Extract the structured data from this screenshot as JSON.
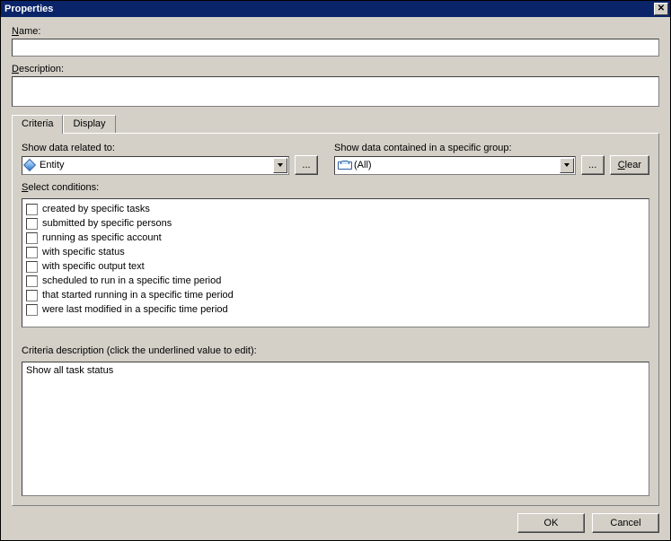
{
  "window": {
    "title": "Properties"
  },
  "fields": {
    "name_label_pre": "N",
    "name_label_post": "ame:",
    "name_value": "",
    "desc_label_pre": "D",
    "desc_label_post": "escription:",
    "desc_value": ""
  },
  "tabs": {
    "criteria": "Criteria",
    "display": "Display"
  },
  "criteria_panel": {
    "related_label": "Show data related to:",
    "related_value": "Entity",
    "group_label": "Show data contained in a specific group:",
    "group_value": "(All)",
    "browse_label": "...",
    "clear_pre": "C",
    "clear_post": "lear",
    "conditions_label_pre": "S",
    "conditions_label_post": "elect conditions:",
    "conditions": [
      "created by specific tasks",
      "submitted by specific persons",
      "running as specific account",
      "with specific status",
      "with specific output text",
      "scheduled to run in  a specific time period",
      "that started running in a specific time period",
      "were last modified in a specific time period"
    ],
    "desc_label": "Criteria description (click the underlined value to edit):",
    "desc_text": "Show all task status"
  },
  "buttons": {
    "ok": "OK",
    "cancel": "Cancel"
  }
}
